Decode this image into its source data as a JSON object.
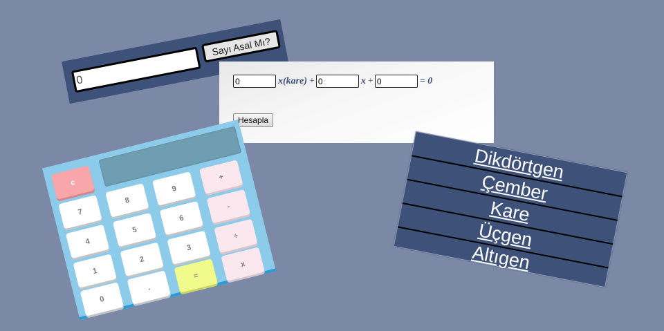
{
  "prime": {
    "input_value": "0",
    "button_label": "Sayı Asal Mı?"
  },
  "quadratic": {
    "a_value": "0",
    "x_squared_label": "x(kare)",
    "plus_1": "+",
    "b_value": "0",
    "x_label": "x",
    "plus_2": "+",
    "c_value": "0",
    "equals_label": "= 0",
    "calculate_button": "Hesapla"
  },
  "calculator": {
    "keys": {
      "clear": "c",
      "k7": "7",
      "k8": "8",
      "k9": "9",
      "plus": "+",
      "k4": "4",
      "k5": "5",
      "k6": "6",
      "minus": "-",
      "k1": "1",
      "k2": "2",
      "k3": "3",
      "divide": "÷",
      "k0": "0",
      "dot": ".",
      "equals": "=",
      "multiply": "x"
    },
    "colors": {
      "body": "#8ccbe9",
      "display": "#6f9db2",
      "clear_key": "#f9a6ab",
      "equals_key": "#f1fb8c",
      "operator_key": "#fbe8ef"
    }
  },
  "shapes_menu": {
    "items": [
      "Dikdörtgen",
      "Çember",
      "Kare",
      "Üçgen",
      "Altıgen"
    ],
    "background": "#3e5179"
  },
  "page": {
    "background": "#7b88a6"
  }
}
